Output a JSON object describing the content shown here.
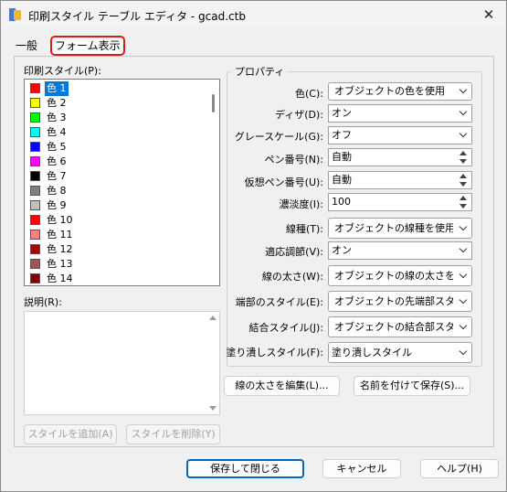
{
  "window": {
    "title": "印刷スタイル テーブル エディタ - gcad.ctb",
    "close_glyph": "✕"
  },
  "tabs": {
    "general": "一般",
    "form": "フォーム表示"
  },
  "left": {
    "styles_label": "印刷スタイル(P):",
    "styles": [
      {
        "name": "色 1",
        "color": "#ff0000",
        "selected": true
      },
      {
        "name": "色 2",
        "color": "#ffff00"
      },
      {
        "name": "色 3",
        "color": "#00ff00"
      },
      {
        "name": "色 4",
        "color": "#00ffff"
      },
      {
        "name": "色 5",
        "color": "#0000ff"
      },
      {
        "name": "色 6",
        "color": "#ff00ff"
      },
      {
        "name": "色 7",
        "color": "#000000"
      },
      {
        "name": "色 8",
        "color": "#808080"
      },
      {
        "name": "色 9",
        "color": "#c0c0c0"
      },
      {
        "name": "色 10",
        "color": "#ff0000"
      },
      {
        "name": "色 11",
        "color": "#ff7f7f"
      },
      {
        "name": "色 12",
        "color": "#a50000"
      },
      {
        "name": "色 13",
        "color": "#a55252"
      },
      {
        "name": "色 14",
        "color": "#7f0000"
      }
    ],
    "description_label": "説明(R):",
    "add_style_button": "スタイルを追加(A)",
    "delete_style_button": "スタイルを削除(Y)"
  },
  "properties": {
    "group_label": "プロパティ",
    "color_label": "色(C):",
    "color_value": "オブジェクトの色を使用",
    "dither_label": "ディザ(D):",
    "dither_value": "オン",
    "grayscale_label": "グレースケール(G):",
    "grayscale_value": "オフ",
    "pen_label": "ペン番号(N):",
    "pen_value": "自動",
    "virtual_pen_label": "仮想ペン番号(U):",
    "virtual_pen_value": "自動",
    "screening_label": "濃淡度(I):",
    "screening_value": "100",
    "linetype_label": "線種(T):",
    "linetype_value": "オブジェクトの線種を使用",
    "adaptive_label": "適応調節(V):",
    "adaptive_value": "オン",
    "lineweight_label": "線の太さ(W):",
    "lineweight_value": "オブジェクトの線の太さを使",
    "endstyle_label": "端部のスタイル(E):",
    "endstyle_value": "オブジェクトの先端部スタ",
    "joinstyle_label": "結合スタイル(J):",
    "joinstyle_value": "オブジェクトの結合部スタ",
    "fillstyle_label": "塗り潰しスタイル(F):",
    "fillstyle_value": "塗り潰しスタイル",
    "edit_lineweights_button": "線の太さを編集(L)...",
    "save_as_button": "名前を付けて保存(S)..."
  },
  "footer": {
    "save_close_button": "保存して閉じる",
    "cancel_button": "キャンセル",
    "help_button": "ヘルプ(H)"
  }
}
